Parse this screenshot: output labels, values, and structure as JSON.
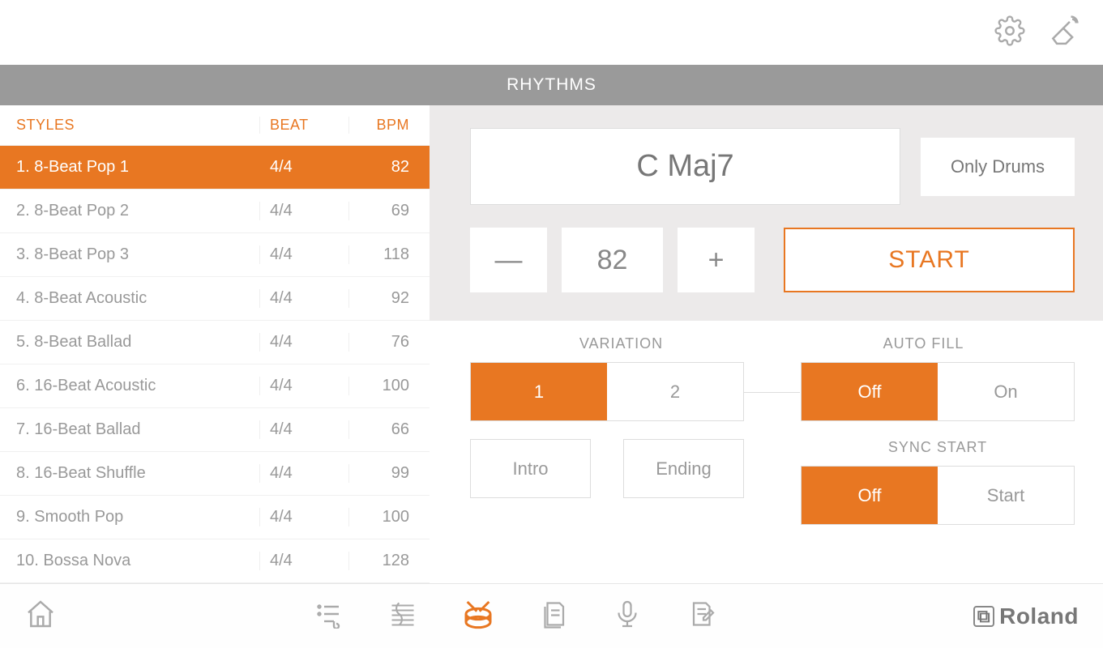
{
  "header": {
    "title": "RHYTHMS"
  },
  "table": {
    "columns": {
      "style": "STYLES",
      "beat": "BEAT",
      "bpm": "BPM"
    },
    "rows": [
      {
        "num": "1.",
        "name": "8-Beat Pop 1",
        "beat": "4/4",
        "bpm": "82",
        "selected": true
      },
      {
        "num": "2.",
        "name": "8-Beat Pop 2",
        "beat": "4/4",
        "bpm": "69",
        "selected": false
      },
      {
        "num": "3.",
        "name": "8-Beat Pop 3",
        "beat": "4/4",
        "bpm": "118",
        "selected": false
      },
      {
        "num": "4.",
        "name": "8-Beat Acoustic",
        "beat": "4/4",
        "bpm": "92",
        "selected": false
      },
      {
        "num": "5.",
        "name": "8-Beat Ballad",
        "beat": "4/4",
        "bpm": "76",
        "selected": false
      },
      {
        "num": "6.",
        "name": "16-Beat Acoustic",
        "beat": "4/4",
        "bpm": "100",
        "selected": false
      },
      {
        "num": "7.",
        "name": "16-Beat Ballad",
        "beat": "4/4",
        "bpm": "66",
        "selected": false
      },
      {
        "num": "8.",
        "name": "16-Beat Shuffle",
        "beat": "4/4",
        "bpm": "99",
        "selected": false
      },
      {
        "num": "9.",
        "name": "Smooth Pop",
        "beat": "4/4",
        "bpm": "100",
        "selected": false
      },
      {
        "num": "10.",
        "name": "Bossa Nova",
        "beat": "4/4",
        "bpm": "128",
        "selected": false
      }
    ]
  },
  "controls": {
    "chord": "C Maj7",
    "only_drums": "Only Drums",
    "tempo": {
      "minus": "—",
      "value": "82",
      "plus": "+"
    },
    "start": "START",
    "variation": {
      "label": "VARIATION",
      "opt1": "1",
      "opt2": "2",
      "active": "1"
    },
    "autofill": {
      "label": "AUTO FILL",
      "opt1": "Off",
      "opt2": "On",
      "active": "Off"
    },
    "intro": "Intro",
    "ending": "Ending",
    "sync": {
      "label": "SYNC START",
      "opt1": "Off",
      "opt2": "Start",
      "active": "Off"
    }
  },
  "brand": "Roland"
}
